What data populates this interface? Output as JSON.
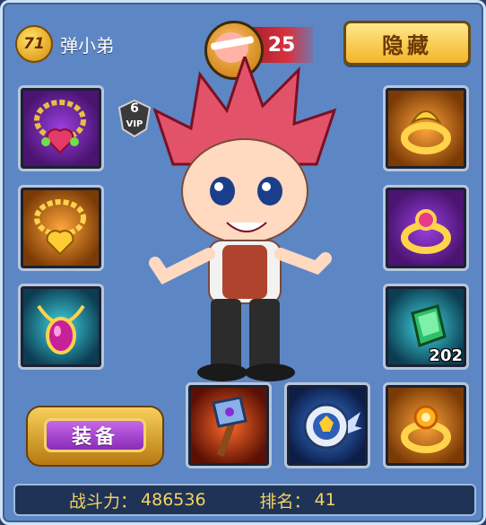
{
  "player": {
    "level": "71",
    "name": "弹小弟"
  },
  "pet": {
    "score": "25"
  },
  "buttons": {
    "hide_label": "隐藏",
    "equip_label": "装备"
  },
  "vip": {
    "level": "6",
    "label": "VIP"
  },
  "slots": {
    "left": [
      {
        "item": "necklace-heart",
        "color": "purple"
      },
      {
        "item": "necklace-gold",
        "color": "orange"
      },
      {
        "item": "amulet-pendant",
        "color": "teal"
      }
    ],
    "right": [
      {
        "item": "ring-gold",
        "color": "orange"
      },
      {
        "item": "ring-jewel",
        "color": "purple"
      },
      {
        "item": "emerald-gem",
        "color": "teal",
        "count": "202"
      }
    ],
    "bottom": [
      {
        "item": "battle-axe",
        "color": "red"
      },
      {
        "item": "winged-shield",
        "color": "blue"
      },
      {
        "item": "ring-sun",
        "color": "orange"
      }
    ]
  },
  "stats": {
    "power_label": "战斗力：",
    "power_value": "486536",
    "rank_label": "排名：",
    "rank_value": "41"
  }
}
